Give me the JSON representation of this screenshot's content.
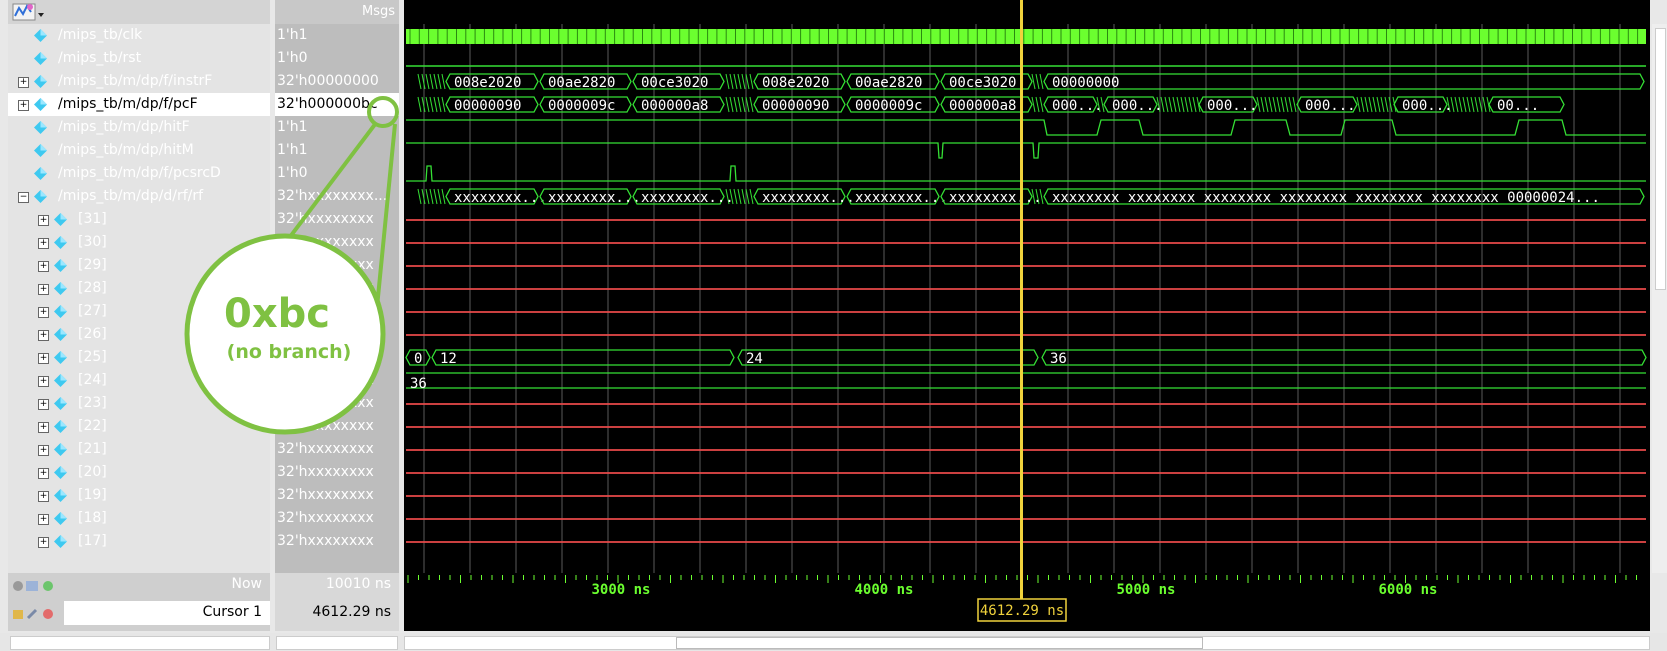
{
  "header": {
    "msgs_label": "Msgs"
  },
  "colors": {
    "clock": "#6bff2f",
    "signal": "#35e035",
    "red": "#e84a4a",
    "cursor": "#f0d23c",
    "highlight": "#7fc142",
    "value_text": "#ffffff"
  },
  "signals": [
    {
      "name": "/mips_tb/clk",
      "value": "1'h1",
      "expandable": false,
      "indent": 0
    },
    {
      "name": "/mips_tb/rst",
      "value": "1'h0",
      "expandable": false,
      "indent": 0
    },
    {
      "name": "/mips_tb/m/dp/f/instrF",
      "value": "32'h00000000",
      "expandable": true,
      "indent": 0
    },
    {
      "name": "/mips_tb/m/dp/f/pcF",
      "value": "32'h000000bc",
      "expandable": true,
      "indent": 0,
      "selected": true
    },
    {
      "name": "/mips_tb/m/dp/hitF",
      "value": "1'h1",
      "expandable": false,
      "indent": 0
    },
    {
      "name": "/mips_tb/m/dp/hitM",
      "value": "1'h1",
      "expandable": false,
      "indent": 0
    },
    {
      "name": "/mips_tb/m/dp/f/pcsrcD",
      "value": "1'h0",
      "expandable": false,
      "indent": 0
    },
    {
      "name": "/mips_tb/m/dp/d/rf/rf",
      "value": "32'hxxxxxxxx...",
      "expandable": true,
      "expanded": true,
      "indent": 0
    },
    {
      "name": "[31]",
      "value": "32'hxxxxxxxx",
      "expandable": true,
      "indent": 1
    },
    {
      "name": "[30]",
      "value": "32'hxxxxxxxx",
      "expandable": true,
      "indent": 1
    },
    {
      "name": "[29]",
      "value": "32'hxxxxxxxx",
      "expandable": true,
      "indent": 1
    },
    {
      "name": "[28]",
      "value": "32'hxxxxxxxx",
      "expandable": true,
      "indent": 1
    },
    {
      "name": "[27]",
      "value": "32'hxxxxxxxx",
      "expandable": true,
      "indent": 1
    },
    {
      "name": "[26]",
      "value": "32'hxxxxxxxx",
      "expandable": true,
      "indent": 1
    },
    {
      "name": "[25]",
      "value": "32'hxxxxxxxx",
      "expandable": true,
      "indent": 1
    },
    {
      "name": "[24]",
      "value": "32'hxxxxxxxx",
      "expandable": true,
      "indent": 1
    },
    {
      "name": "[23]",
      "value": "32'hxxxxxxxx",
      "expandable": true,
      "indent": 1
    },
    {
      "name": "[22]",
      "value": "32'hxxxxxxxx",
      "expandable": true,
      "indent": 1
    },
    {
      "name": "[21]",
      "value": "32'hxxxxxxxx",
      "expandable": true,
      "indent": 1
    },
    {
      "name": "[20]",
      "value": "32'hxxxxxxxx",
      "expandable": true,
      "indent": 1
    },
    {
      "name": "[19]",
      "value": "32'hxxxxxxxx",
      "expandable": true,
      "indent": 1
    },
    {
      "name": "[18]",
      "value": "32'hxxxxxxxx",
      "expandable": true,
      "indent": 1
    },
    {
      "name": "[17]",
      "value": "32'hxxxxxxxx",
      "expandable": true,
      "indent": 1
    }
  ],
  "waves": {
    "instrF_labels": [
      "008e2020",
      "00ae2820",
      "00ce3020",
      "008e2020",
      "00ae2820",
      "00ce3020",
      "00000000"
    ],
    "pcF_labels": [
      "00000090",
      "0000009c",
      "000000a8",
      "00000090",
      "0000009c",
      "000000a8",
      "000...",
      "000...",
      "000...",
      "000...",
      "000...",
      "00..."
    ],
    "rf_labels": [
      "xxxxxxxx...",
      "xxxxxxxx...",
      "xxxxxxxx...",
      "xxxxxxxx...",
      "xxxxxxxx...",
      "xxxxxxxx...",
      "xxxxxxxx xxxxxxxx xxxxxxxx xxxxxxxx xxxxxxxx xxxxxxxx 00000024..."
    ],
    "r25_labels": [
      "0",
      "12",
      "24",
      "36"
    ],
    "r24_labels": [
      "36"
    ]
  },
  "status": {
    "now_label": "Now",
    "now_value": "10010 ns",
    "cursor_label": "Cursor 1",
    "cursor_value": "4612.29 ns",
    "cursor_time_tag": "4612.29 ns",
    "time_ticks": [
      "3000 ns",
      "4000 ns",
      "5000 ns",
      "6000 ns"
    ]
  },
  "annotation": {
    "line1": "0xbc",
    "line2": "(no branch)"
  },
  "icons": {
    "wave-toolbar": "wave-icon",
    "signal": "diamond-icon",
    "status-now": "clock-icon",
    "status-cursor": "lock-icon"
  }
}
